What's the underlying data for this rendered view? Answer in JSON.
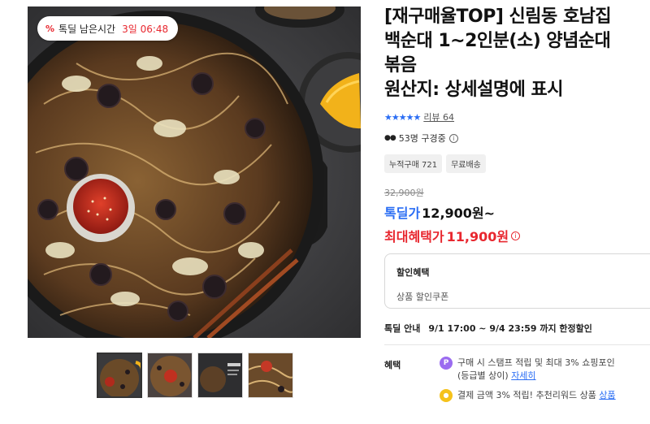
{
  "deal_timer": {
    "icon": "percent-tag-icon",
    "label": "톡딜 남은시간",
    "time": "3일 06:48"
  },
  "product": {
    "title_lines": [
      "[재구매율TOP] 신림동 호남집",
      "백순대 1~2인분(소) 양념순대",
      "볶음",
      "원산지: 상세설명에 표시"
    ],
    "rating_stars": "★★★★★",
    "review_text": "리뷰 64",
    "viewers": "53명 구경중",
    "tags": [
      "누적구매 721",
      "무료배송"
    ]
  },
  "price": {
    "original": "32,900원",
    "deal_label": "톡딜가",
    "deal_price": "12,900원~",
    "max_benefit_label": "최대혜택가",
    "max_benefit_price": "11,900원"
  },
  "discount_box": {
    "title": "할인혜택",
    "subtitle": "상품 할인쿠폰"
  },
  "sale_info": {
    "label": "톡딜 안내",
    "dates": "9/1 17:00 ~ 9/4 23:59 까지 한정할인"
  },
  "benefits": {
    "heading": "혜택",
    "item1_text": "구매 시 스탬프 적립 및 최대 3% 쇼핑포인",
    "item1_text2": "(등급별 상이)",
    "item1_link": "자세히",
    "item2_text": "결제 금액 3% 적립! 추천리워드 상품",
    "item2_link": "상품"
  },
  "colors": {
    "deal_blue": "#2a6df4",
    "benefit_red": "#e8272f"
  }
}
